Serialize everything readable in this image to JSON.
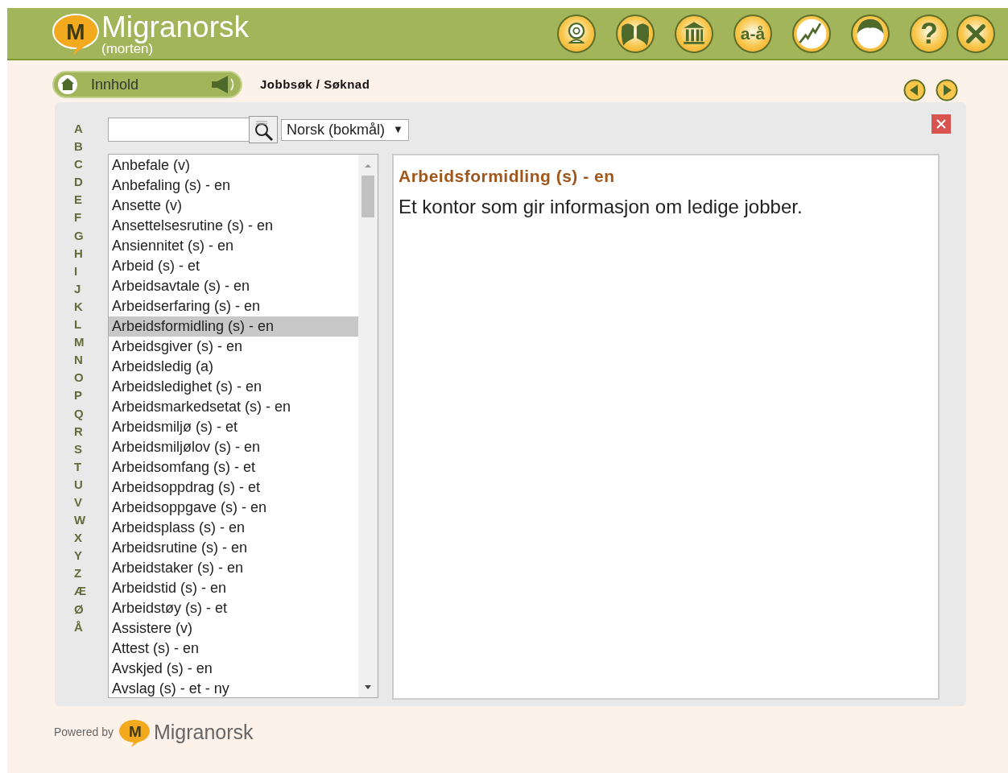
{
  "header": {
    "logo_letter": "M",
    "brand": "Migranorsk",
    "user": "(morten)",
    "buttons": [
      {
        "kind": "webcam"
      },
      {
        "kind": "people"
      },
      {
        "kind": "museum"
      },
      {
        "kind": "letters",
        "label": "a-å"
      },
      {
        "kind": "chart"
      },
      {
        "kind": "face"
      },
      {
        "kind": "help",
        "label": "?"
      },
      {
        "kind": "close"
      }
    ]
  },
  "nav": {
    "home_label": "Innhold",
    "breadcrumb": "Jobbsøk / Søknad"
  },
  "alphabet": [
    "A",
    "B",
    "C",
    "D",
    "E",
    "F",
    "G",
    "H",
    "I",
    "J",
    "K",
    "L",
    "M",
    "N",
    "O",
    "P",
    "Q",
    "R",
    "S",
    "T",
    "U",
    "V",
    "W",
    "X",
    "Y",
    "Z",
    "Æ",
    "Ø",
    "Å"
  ],
  "search": {
    "language": "Norsk (bokmål)",
    "dropdown_arrow": "▼"
  },
  "words": [
    {
      "text": "Anbefale (v)",
      "selected": false
    },
    {
      "text": "Anbefaling (s) - en",
      "selected": false
    },
    {
      "text": "Ansette (v)",
      "selected": false
    },
    {
      "text": "Ansettelsesrutine (s) - en",
      "selected": false
    },
    {
      "text": "Ansiennitet (s) - en",
      "selected": false
    },
    {
      "text": "Arbeid (s) - et",
      "selected": false
    },
    {
      "text": "Arbeidsavtale (s) - en",
      "selected": false
    },
    {
      "text": "Arbeidserfaring (s) - en",
      "selected": false
    },
    {
      "text": "Arbeidsformidling (s) - en",
      "selected": true
    },
    {
      "text": "Arbeidsgiver (s) - en",
      "selected": false
    },
    {
      "text": "Arbeidsledig (a)",
      "selected": false
    },
    {
      "text": "Arbeidsledighet (s) - en",
      "selected": false
    },
    {
      "text": "Arbeidsmarkedsetat (s) - en",
      "selected": false
    },
    {
      "text": "Arbeidsmiljø (s) - et",
      "selected": false
    },
    {
      "text": "Arbeidsmiljølov (s) - en",
      "selected": false
    },
    {
      "text": "Arbeidsomfang (s) - et",
      "selected": false
    },
    {
      "text": "Arbeidsoppdrag (s) - et",
      "selected": false
    },
    {
      "text": "Arbeidsoppgave (s) - en",
      "selected": false
    },
    {
      "text": "Arbeidsplass (s) - en",
      "selected": false
    },
    {
      "text": "Arbeidsrutine (s) - en",
      "selected": false
    },
    {
      "text": "Arbeidstaker (s) - en",
      "selected": false
    },
    {
      "text": "Arbeidstid (s) - en",
      "selected": false
    },
    {
      "text": "Arbeidstøy (s) - et",
      "selected": false
    },
    {
      "text": "Assistere (v)",
      "selected": false
    },
    {
      "text": "Attest (s) - en",
      "selected": false
    },
    {
      "text": "Avskjed (s) - en",
      "selected": false
    },
    {
      "text": "Avslag (s) - et - ny",
      "selected": false
    }
  ],
  "definition": {
    "title": "Arbeidsformidling (s) - en",
    "text": "Et kontor som gir informasjon om ledige jobber."
  },
  "footer": {
    "powered_by": "Powered by",
    "logo_letter": "M",
    "brand": "Migranorsk"
  }
}
